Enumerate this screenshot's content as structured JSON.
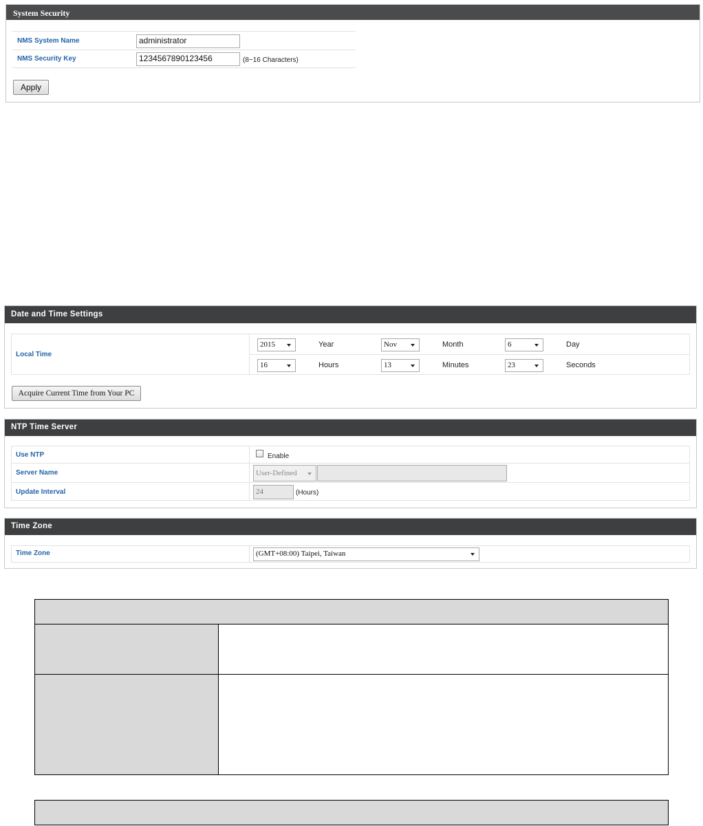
{
  "system_security": {
    "title": "System Security",
    "nms_name_label": "NMS System Name",
    "nms_name_value": "administrator",
    "nms_key_label": "NMS Security Key",
    "nms_key_value": "1234567890123456",
    "nms_key_hint": "(8~16 Characters)",
    "apply_label": "Apply"
  },
  "date_time": {
    "title": "Date and Time Settings",
    "local_time_label": "Local Time",
    "year_value": "2015",
    "year_label": "Year",
    "month_value": "Nov",
    "month_label": "Month",
    "day_value": "6",
    "day_label": "Day",
    "hours_value": "16",
    "hours_label": "Hours",
    "minutes_value": "13",
    "minutes_label": "Minutes",
    "seconds_value": "23",
    "seconds_label": "Seconds",
    "acquire_label": "Acquire Current Time from Your PC"
  },
  "ntp": {
    "title": "NTP Time Server",
    "use_ntp_label": "Use NTP",
    "enable_label": "Enable",
    "server_name_label": "Server Name",
    "server_select_value": "User-Defined",
    "server_input_value": "",
    "update_interval_label": "Update Interval",
    "update_interval_value": "24",
    "hours_unit": "(Hours)"
  },
  "time_zone": {
    "title": "Time Zone",
    "label": "Time Zone",
    "value": "(GMT+08:00) Taipei, Taiwan"
  }
}
